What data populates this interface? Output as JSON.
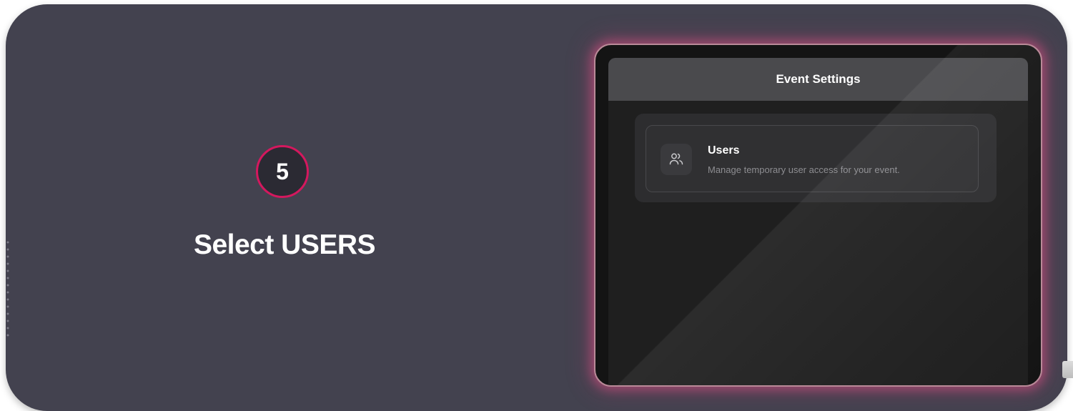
{
  "step": {
    "number": "5",
    "title": "Select USERS"
  },
  "device_screen": {
    "header_title": "Event Settings",
    "menu_items": [
      {
        "icon": "users-icon",
        "label": "Users",
        "description": "Manage temporary user access for your event."
      }
    ]
  },
  "colors": {
    "card_background": "#43424f",
    "badge_accent": "#d4185e",
    "device_glow": "#cd5082"
  }
}
